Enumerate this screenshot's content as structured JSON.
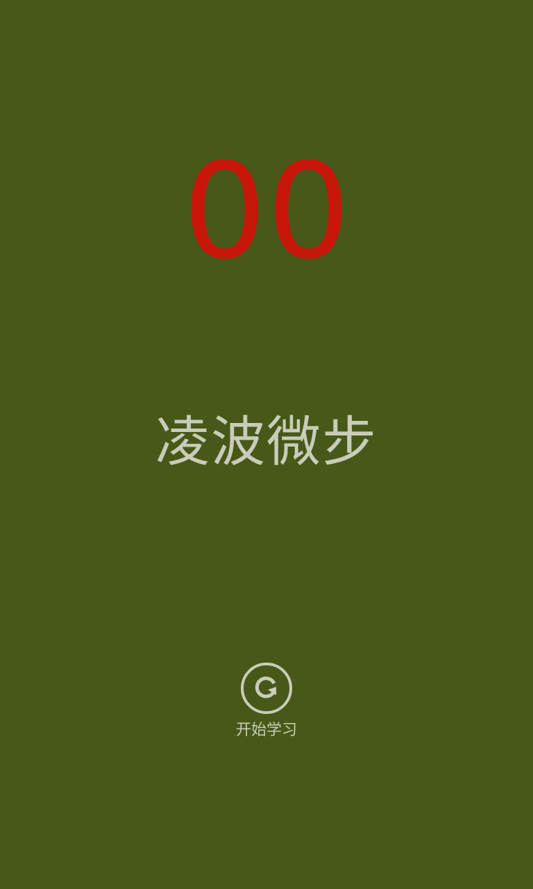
{
  "screen": {
    "counter": "00",
    "title": "凌波微步",
    "start_button": {
      "label": "开始学习",
      "icon": "refresh-circle-icon"
    }
  },
  "colors": {
    "background": "#485818",
    "counter": "#c8160a",
    "text": "#c9ccba"
  }
}
